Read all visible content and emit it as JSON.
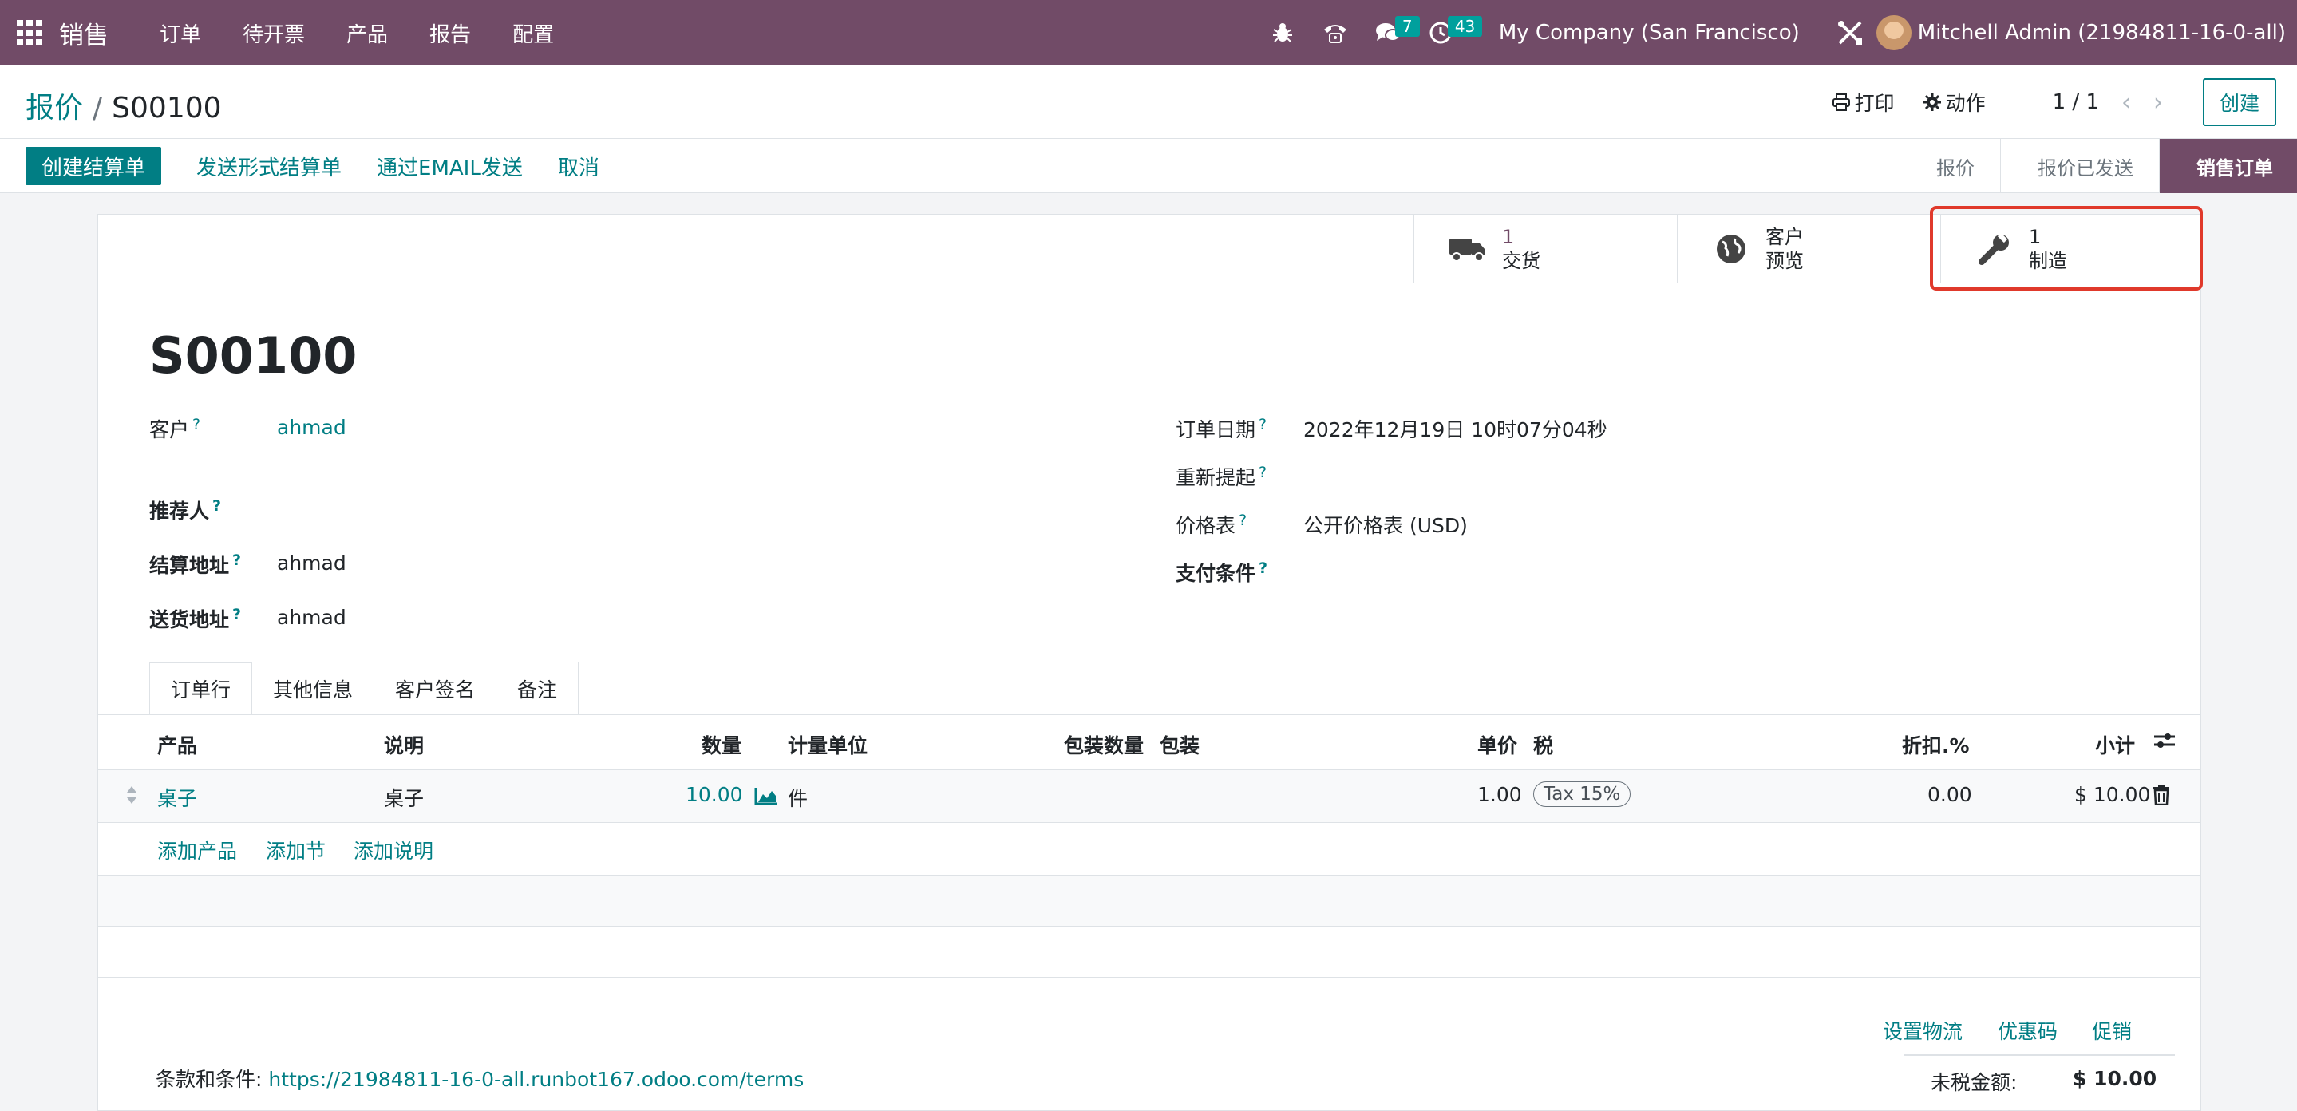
{
  "navbar": {
    "brand": "销售",
    "menu": [
      "订单",
      "待开票",
      "产品",
      "报告",
      "配置"
    ],
    "messages_count": "7",
    "activities_count": "43",
    "company": "My Company (San Francisco)",
    "user": "Mitchell Admin (21984811-16-0-all)"
  },
  "control_panel": {
    "breadcrumb_parent": "报价",
    "breadcrumb_current": "S00100",
    "print_label": "打印",
    "action_label": "动作",
    "pager": "1 / 1",
    "create_label": "创建"
  },
  "statusbar": {
    "create_invoice": "创建结算单",
    "send_proforma": "发送形式结算单",
    "send_email": "通过EMAIL发送",
    "cancel": "取消",
    "stages": [
      "报价",
      "报价已发送",
      "销售订单"
    ]
  },
  "smart_buttons": {
    "delivery": {
      "count": "1",
      "label": "交货"
    },
    "preview": {
      "line1": "客户",
      "line2": "预览"
    },
    "manufacturing": {
      "count": "1",
      "label": "制造"
    }
  },
  "form": {
    "title": "S00100",
    "customer_label": "客户",
    "customer_value": "ahmad",
    "referrer_label": "推荐人",
    "invoice_address_label": "结算地址",
    "invoice_address_value": "ahmad",
    "delivery_address_label": "送货地址",
    "delivery_address_value": "ahmad",
    "order_date_label": "订单日期",
    "order_date_value": "2022年12月19日 10时07分04秒",
    "reminder_label": "重新提起",
    "pricelist_label": "价格表",
    "pricelist_value": "公开价格表 (USD)",
    "payment_terms_label": "支付条件",
    "help_mark": "?"
  },
  "tabs": [
    "订单行",
    "其他信息",
    "客户签名",
    "备注"
  ],
  "table": {
    "headers": {
      "product": "产品",
      "description": "说明",
      "quantity": "数量",
      "uom": "计量单位",
      "pkg_qty": "包装数量",
      "packaging": "包装",
      "unit_price": "单价",
      "tax": "税",
      "discount": "折扣.%",
      "subtotal": "小计"
    },
    "rows": [
      {
        "product": "桌子",
        "description": "桌子",
        "quantity": "10.00",
        "uom": "件",
        "unit_price": "1.00",
        "tax": "Tax 15%",
        "discount": "0.00",
        "subtotal": "$ 10.00"
      }
    ],
    "add_product": "添加产品",
    "add_section": "添加节",
    "add_note": "添加说明"
  },
  "footer": {
    "set_shipping": "设置物流",
    "coupon": "优惠码",
    "promotion": "促销",
    "terms_label": "条款和条件:",
    "terms_link": "https://21984811-16-0-all.runbot167.odoo.com/terms",
    "untaxed_label": "未税金额:",
    "untaxed_value": "$ 10.00"
  },
  "colors": {
    "brand": "#714b67",
    "accent": "#017e84",
    "highlight": "#e0392b"
  }
}
